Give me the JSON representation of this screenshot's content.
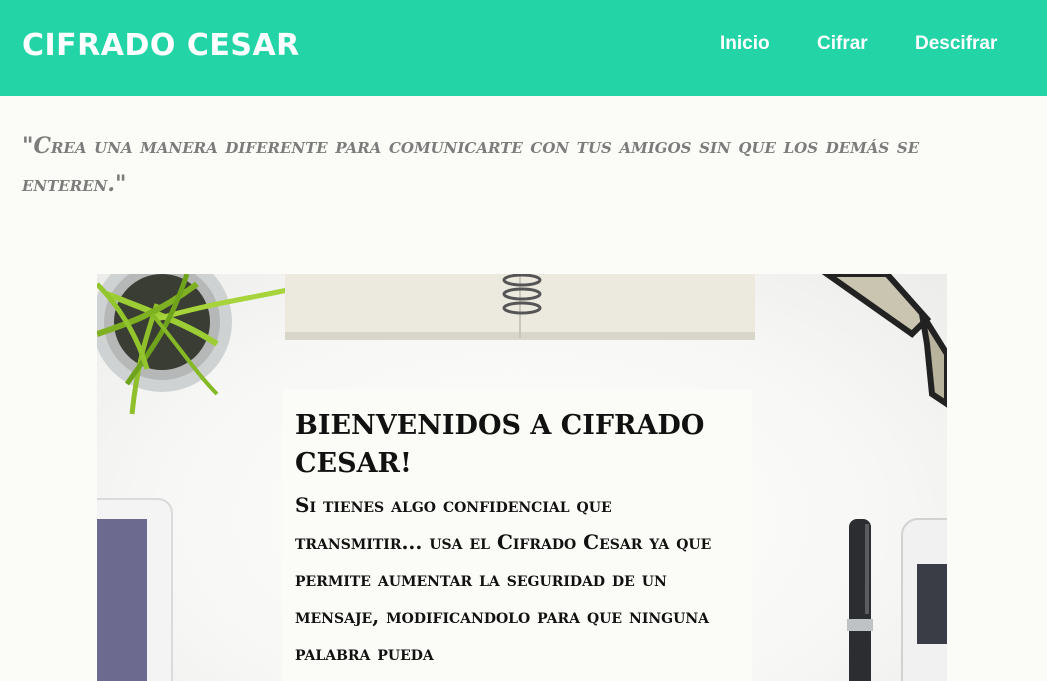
{
  "header": {
    "brand": "CIFRADO CESAR",
    "nav": {
      "inicio": "Inicio",
      "cifrar": "Cifrar",
      "descifrar": "Descifrar"
    }
  },
  "tagline": "\"Crea una manera diferente para comunicarte con tus amigos sin que los demás se enteren.\"",
  "hero": {
    "title": "BIENVENIDOS A CIFRADO CESAR!",
    "text": "Si tienes algo confidencial que transmitir... usa el Cifrado Cesar ya que permite aumentar la seguridad de un mensaje, modificandolo para que ninguna palabra pueda"
  },
  "colors": {
    "header_bg": "#23d4a6",
    "page_bg": "#fbfbf7",
    "tagline": "#7c7c7c",
    "hero_text": "#111111"
  }
}
